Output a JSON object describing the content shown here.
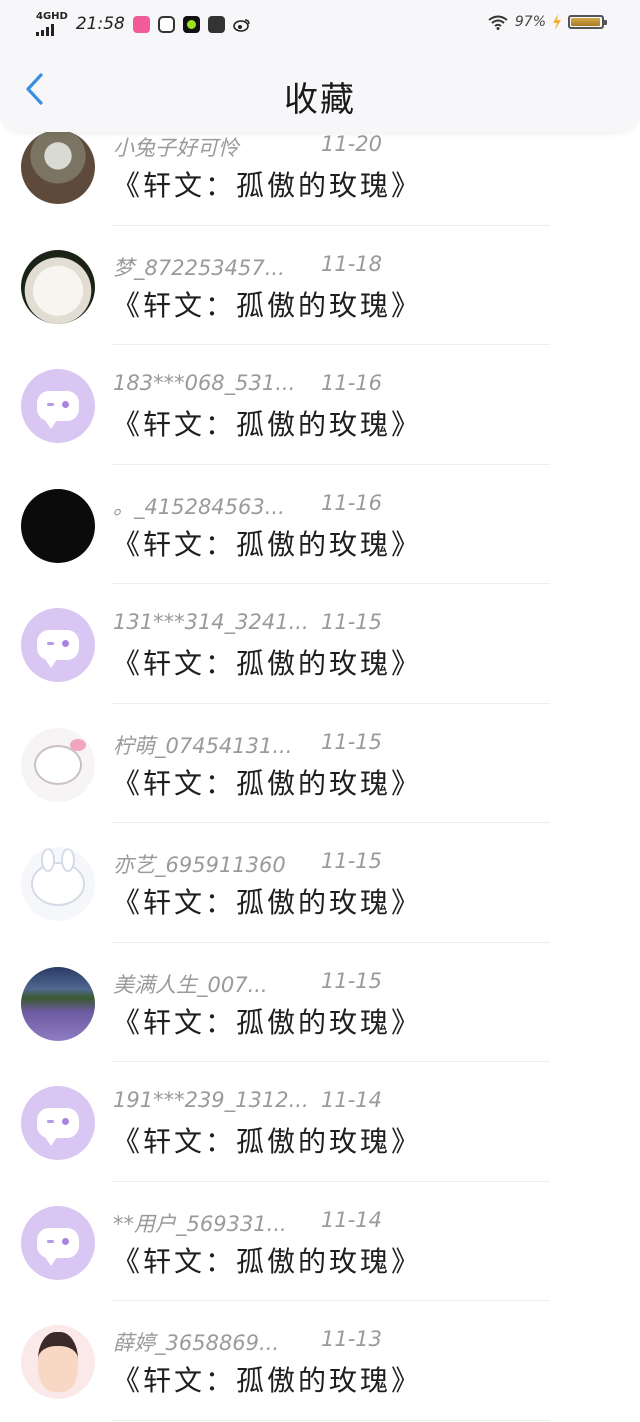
{
  "status_bar": {
    "network": "4GHD",
    "time": "21:58",
    "battery_percent": "97%",
    "battery_level": 0.97
  },
  "header": {
    "title": "收藏"
  },
  "items": [
    {
      "user": "小兔子好可怜",
      "date": "11-20",
      "title": "《轩文：孤傲的玫瑰》",
      "avatar": "photo"
    },
    {
      "user": "梦_872253457...",
      "date": "11-18",
      "title": "《轩文：孤傲的玫瑰》",
      "avatar": "sheep"
    },
    {
      "user": "183***068_531...",
      "date": "11-16",
      "title": "《轩文：孤傲的玫瑰》",
      "avatar": "default"
    },
    {
      "user": "。_415284563...",
      "date": "11-16",
      "title": "《轩文：孤傲的玫瑰》",
      "avatar": "black"
    },
    {
      "user": "131***314_3241...",
      "date": "11-15",
      "title": "《轩文：孤傲的玫瑰》",
      "avatar": "default"
    },
    {
      "user": "柠萌_07454131...",
      "date": "11-15",
      "title": "《轩文：孤傲的玫瑰》",
      "avatar": "kitty"
    },
    {
      "user": "亦艺_695911360",
      "date": "11-15",
      "title": "《轩文：孤傲的玫瑰》",
      "avatar": "bunny"
    },
    {
      "user": "美满人生_007...",
      "date": "11-15",
      "title": "《轩文：孤傲的玫瑰》",
      "avatar": "lavender"
    },
    {
      "user": "191***239_1312...",
      "date": "11-14",
      "title": "《轩文：孤傲的玫瑰》",
      "avatar": "default"
    },
    {
      "user": "**用户_569331...",
      "date": "11-14",
      "title": "《轩文：孤傲的玫瑰》",
      "avatar": "default"
    },
    {
      "user": "薛婷_3658869...",
      "date": "11-13",
      "title": "《轩文：孤傲的玫瑰》",
      "avatar": "girl"
    }
  ],
  "colors": {
    "accent": "#3b8fe0",
    "default_avatar": "#d9c6f2"
  }
}
